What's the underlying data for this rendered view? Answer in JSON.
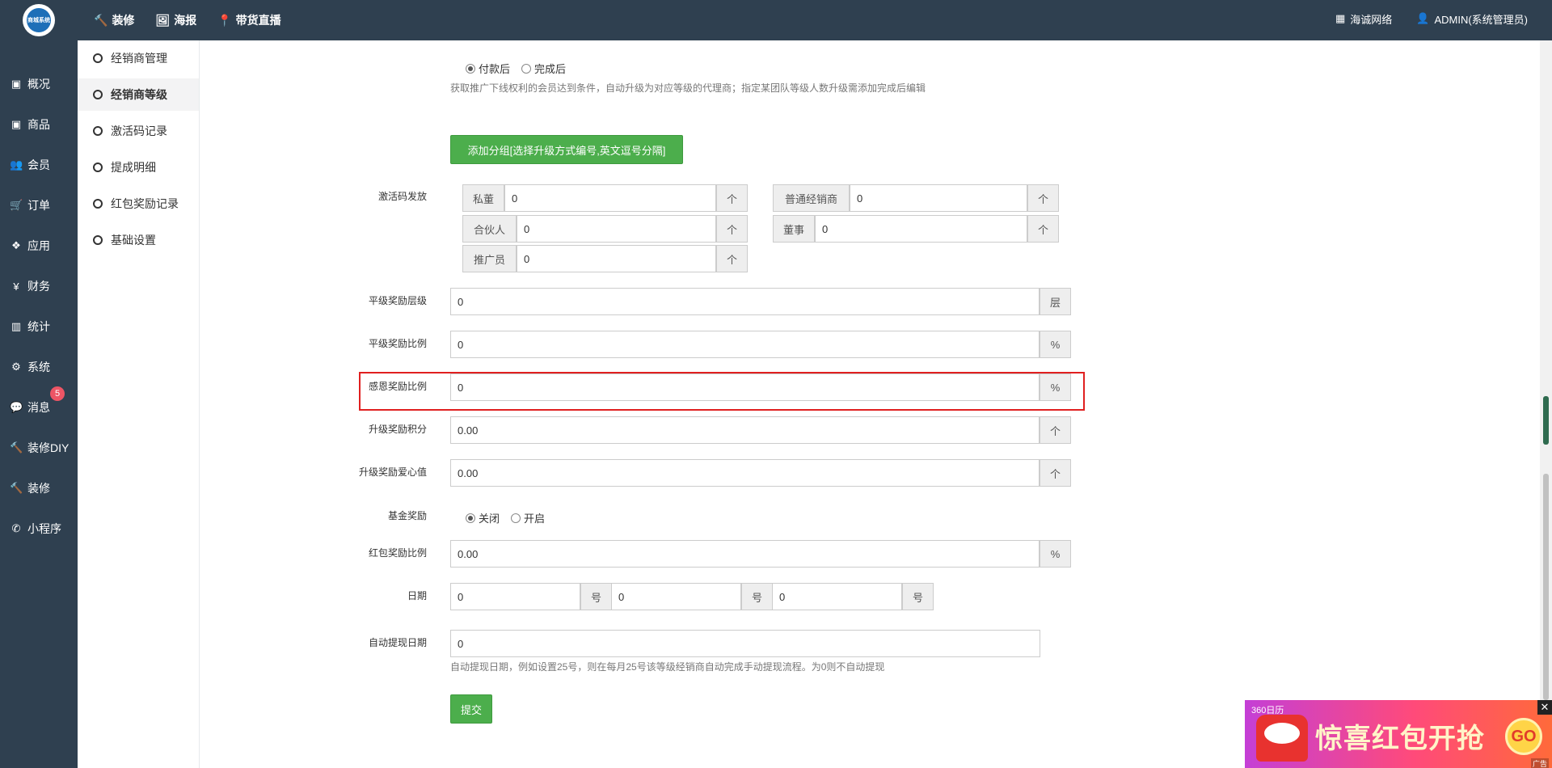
{
  "colors": {
    "sidebar_bg": "#2f4050",
    "accent_green": "#4cae4c",
    "highlight_red": "#e02020",
    "badge_red": "#ed5565"
  },
  "header": {
    "logo_text": "商城系统",
    "nav": [
      {
        "icon": "hammer-icon",
        "label": "装修"
      },
      {
        "icon": "image-icon",
        "label": "海报"
      },
      {
        "icon": "pin-icon",
        "label": "带货直播"
      }
    ],
    "brand": "海诚网络",
    "user": "ADMIN(系统管理员)"
  },
  "sidebar": {
    "items": [
      {
        "icon": "archive-icon",
        "label": "概况"
      },
      {
        "icon": "box-icon",
        "label": "商品"
      },
      {
        "icon": "users-icon",
        "label": "会员"
      },
      {
        "icon": "cart-icon",
        "label": "订单"
      },
      {
        "icon": "cubes-icon",
        "label": "应用"
      },
      {
        "icon": "yen-icon",
        "label": "财务"
      },
      {
        "icon": "bar-chart-icon",
        "label": "统计"
      },
      {
        "icon": "gears-icon",
        "label": "系统"
      },
      {
        "icon": "chat-icon",
        "label": "消息",
        "badge": "5"
      },
      {
        "icon": "hammer-icon",
        "label": "装修DIY"
      },
      {
        "icon": "hammer-icon",
        "label": "装修"
      },
      {
        "icon": "wechat-icon",
        "label": "小程序"
      }
    ]
  },
  "submenu": {
    "items": [
      {
        "label": "经销商管理"
      },
      {
        "label": "经销商等级",
        "active": true
      },
      {
        "label": "激活码记录"
      },
      {
        "label": "提成明细"
      },
      {
        "label": "红包奖励记录"
      },
      {
        "label": "基础设置"
      }
    ]
  },
  "form": {
    "upgrade_timing": {
      "options": [
        "付款后",
        "完成后"
      ],
      "selected": "付款后"
    },
    "upgrade_help": "获取推广下线权利的会员达到条件，自动升级为对应等级的代理商；指定某团队等级人数升级需添加完成后编辑",
    "add_group_button": "添加分组[选择升级方式编号,英文逗号分隔]",
    "activation": {
      "label": "激活码发放",
      "fields": [
        {
          "addon": "私董",
          "value": "0",
          "unit": "个"
        },
        {
          "addon": "普通经销商",
          "value": "0",
          "unit": "个"
        },
        {
          "addon": "合伙人",
          "value": "0",
          "unit": "个"
        },
        {
          "addon": "董事",
          "value": "0",
          "unit": "个"
        },
        {
          "addon": "推广员",
          "value": "0",
          "unit": "个"
        }
      ]
    },
    "level_reward_layers": {
      "label": "平级奖励层级",
      "value": "0",
      "unit": "层"
    },
    "level_reward_ratio": {
      "label": "平级奖励比例",
      "value": "0",
      "unit": "%"
    },
    "gratitude_ratio": {
      "label": "感恩奖励比例",
      "value": "0",
      "unit": "%"
    },
    "upgrade_points": {
      "label": "升级奖励积分",
      "value": "0.00",
      "unit": "个"
    },
    "upgrade_love": {
      "label": "升级奖励爱心值",
      "value": "0.00",
      "unit": "个"
    },
    "fund_reward": {
      "label": "基金奖励",
      "options": [
        "关闭",
        "开启"
      ],
      "selected": "关闭"
    },
    "redpacket_ratio": {
      "label": "红包奖励比例",
      "value": "0.00",
      "unit": "%"
    },
    "date": {
      "label": "日期",
      "values": [
        "0",
        "0",
        "0"
      ],
      "unit": "号"
    },
    "auto_withdraw": {
      "label": "自动提现日期",
      "value": "0",
      "help": "自动提现日期，例如设置25号，则在每月25号该等级经销商自动完成手动提现流程。为0则不自动提现"
    },
    "submit_button": "提交"
  },
  "ad": {
    "tag": "360日历",
    "title": "惊喜红包开抢",
    "go": "GO",
    "close": "✕",
    "flag": "广告"
  }
}
